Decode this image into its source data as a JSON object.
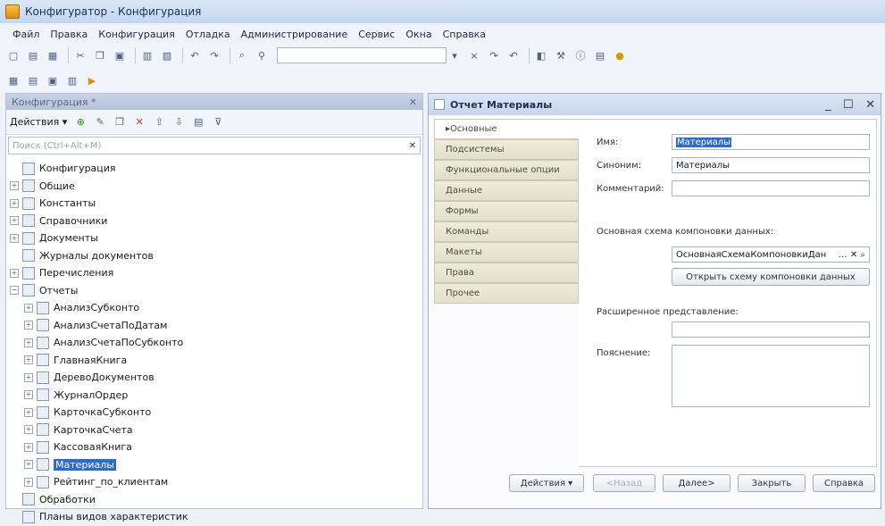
{
  "app": {
    "title": "Конфигуратор - Конфигурация"
  },
  "menu": [
    "Файл",
    "Правка",
    "Конфигурация",
    "Отладка",
    "Администрирование",
    "Сервис",
    "Окна",
    "Справка"
  ],
  "config_panel": {
    "header": "Конфигурация *",
    "actions_label": "Действия ▾",
    "quick_search_placeholder": "Поиск (Ctrl+Alt+M)",
    "tree": [
      {
        "label": "Конфигурация",
        "level": 0,
        "expander": "none",
        "icon": "config-icon"
      },
      {
        "label": "Общие",
        "level": 1,
        "expander": "+",
        "icon": "common-icon"
      },
      {
        "label": "Константы",
        "level": 1,
        "expander": "+",
        "icon": "constants-icon"
      },
      {
        "label": "Справочники",
        "level": 1,
        "expander": "+",
        "icon": "catalogs-icon"
      },
      {
        "label": "Документы",
        "level": 1,
        "expander": "+",
        "icon": "documents-icon"
      },
      {
        "label": "Журналы документов",
        "level": 1,
        "expander": "none",
        "icon": "journals-icon"
      },
      {
        "label": "Перечисления",
        "level": 1,
        "expander": "+",
        "icon": "enums-icon"
      },
      {
        "label": "Отчеты",
        "level": 1,
        "expander": "−",
        "icon": "reports-icon"
      },
      {
        "label": "АнализСубконто",
        "level": 2,
        "expander": "+",
        "icon": "report-icon"
      },
      {
        "label": "АнализСчетаПоДатам",
        "level": 2,
        "expander": "+",
        "icon": "report-icon"
      },
      {
        "label": "АнализСчетаПоСубконто",
        "level": 2,
        "expander": "+",
        "icon": "report-icon"
      },
      {
        "label": "ГлавнаяКнига",
        "level": 2,
        "expander": "+",
        "icon": "report-icon"
      },
      {
        "label": "ДеревоДокументов",
        "level": 2,
        "expander": "+",
        "icon": "report-icon"
      },
      {
        "label": "ЖурналОрдер",
        "level": 2,
        "expander": "+",
        "icon": "report-icon"
      },
      {
        "label": "КарточкаСубконто",
        "level": 2,
        "expander": "+",
        "icon": "report-icon"
      },
      {
        "label": "КарточкаСчета",
        "level": 2,
        "expander": "+",
        "icon": "report-icon"
      },
      {
        "label": "КассоваяКнига",
        "level": 2,
        "expander": "+",
        "icon": "report-icon"
      },
      {
        "label": "Материалы",
        "level": 2,
        "expander": "+",
        "icon": "report-icon",
        "selected": true
      },
      {
        "label": "Рейтинг_по_клиентам",
        "level": 2,
        "expander": "+",
        "icon": "report-icon"
      },
      {
        "label": "Обработки",
        "level": 1,
        "expander": "none",
        "icon": "processing-icon"
      },
      {
        "label": "Планы видов характеристик",
        "level": 1,
        "expander": "none",
        "icon": "chart-types-icon"
      }
    ]
  },
  "report_window": {
    "title": "Отчет Материалы",
    "tabs": [
      "Основные",
      "Подсистемы",
      "Функциональные опции",
      "Данные",
      "Формы",
      "Команды",
      "Макеты",
      "Права",
      "Прочее"
    ],
    "active_tab": "Основные",
    "name_label": "Имя:",
    "name_value": "Материалы",
    "synonym_label": "Синоним:",
    "synonym_value": "Материалы",
    "comment_label": "Комментарий:",
    "comment_value": "",
    "schema_label": "Основная схема компоновки данных:",
    "schema_value": "ОсновнаяСхемаКомпоновкиДан",
    "open_schema_button": "Открыть схему компоновки данных",
    "extended_label": "Расширенное представление:",
    "explanation_label": "Пояснение:",
    "buttons": {
      "actions": "Действия ▾",
      "back": "<Назад",
      "next": "Далее>",
      "close": "Закрыть",
      "help": "Справка"
    }
  }
}
